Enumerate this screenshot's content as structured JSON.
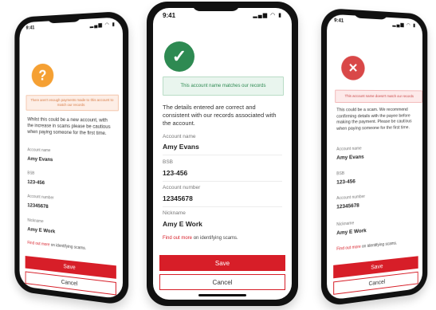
{
  "status_bar": {
    "time": "9:41",
    "icons": "▂▄▆ ◠ ▮"
  },
  "colors": {
    "success": "#2e8a52",
    "warning": "#f5a033",
    "error": "#d94848",
    "brand": "#d71e28"
  },
  "left_screen": {
    "status_icon": "question-mark-icon",
    "icon_glyph": "?",
    "banner": "There aren't enough payments made to this account to match our records",
    "message": "Whilst this could be a new account, with the increase in scams please be cautious when paying someone for the first time.",
    "fields": [
      {
        "label": "Account name",
        "value": "Amy Evans"
      },
      {
        "label": "BSB",
        "value": "123-456"
      },
      {
        "label": "Account number",
        "value": "12345678"
      },
      {
        "label": "Nickname",
        "value": "Amy E Work"
      }
    ],
    "link_text": "Find out more",
    "link_suffix": " on identifying scams.",
    "save_label": "Save",
    "cancel_label": "Cancel"
  },
  "center_screen": {
    "status_icon": "check-icon",
    "icon_glyph": "✓",
    "banner": "This account name matches our records",
    "message": "The details entered are correct and consistent with our records associated with the account.",
    "fields": [
      {
        "label": "Account name",
        "value": "Amy Evans"
      },
      {
        "label": "BSB",
        "value": "123-456"
      },
      {
        "label": "Account number",
        "value": "12345678"
      },
      {
        "label": "Nickname",
        "value": "Amy E Work"
      }
    ],
    "link_text": "Find out more",
    "link_suffix": " on identifying scams.",
    "save_label": "Save",
    "cancel_label": "Cancel"
  },
  "right_screen": {
    "status_icon": "cross-icon",
    "icon_glyph": "✕",
    "banner": "This account name doesn't match our records",
    "message": "This could be a scam. We recommend confirming details with the payee before making the payment. Please be cautious when paying someone for the first time.",
    "fields": [
      {
        "label": "Account name",
        "value": "Amy Evans"
      },
      {
        "label": "BSB",
        "value": "123-456"
      },
      {
        "label": "Account number",
        "value": "12345678"
      },
      {
        "label": "Nickname",
        "value": "Amy E Work"
      }
    ],
    "link_text": "Find out more",
    "link_suffix": " on identifying scams.",
    "save_label": "Save",
    "cancel_label": "Cancel"
  }
}
